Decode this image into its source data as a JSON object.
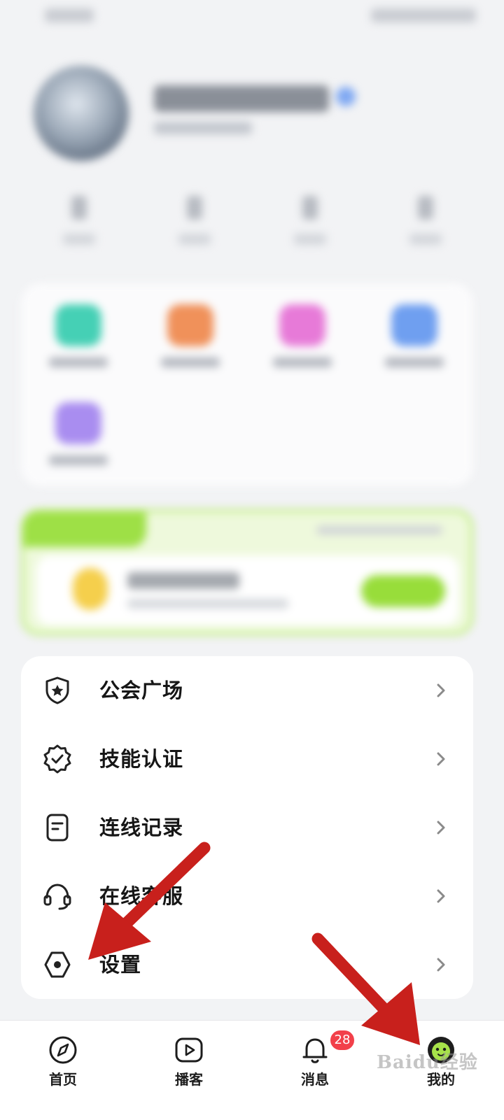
{
  "menu": {
    "items": [
      {
        "label": "公会广场",
        "icon": "shield-star-icon"
      },
      {
        "label": "技能认证",
        "icon": "certified-badge-icon"
      },
      {
        "label": "连线记录",
        "icon": "document-icon"
      },
      {
        "label": "在线客服",
        "icon": "headset-icon"
      },
      {
        "label": "设置",
        "icon": "settings-hexagon-icon"
      }
    ]
  },
  "bottom_nav": {
    "items": [
      {
        "label": "首页",
        "icon": "compass-icon"
      },
      {
        "label": "播客",
        "icon": "play-icon"
      },
      {
        "label": "消息",
        "icon": "bell-icon",
        "badge": "28"
      },
      {
        "label": "我的",
        "icon": "profile-avatar-icon",
        "active": true
      }
    ]
  },
  "colors": {
    "accent_green": "#9ee046",
    "badge_red": "#f2404a",
    "annotation_arrow": "#c8201c"
  },
  "watermark": "Baidu经验"
}
